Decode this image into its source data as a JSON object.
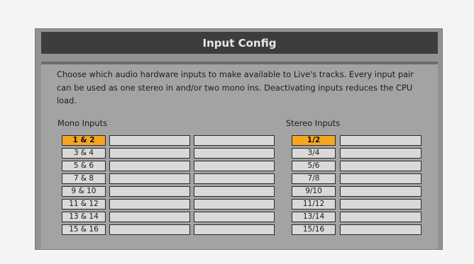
{
  "dialog": {
    "title": "Input Config",
    "description": "Choose which audio hardware inputs to make available to Live's tracks. Every input pair can be used as one stereo in and/or two mono ins.  Deactivating inputs reduces the CPU load."
  },
  "mono": {
    "label": "Mono Inputs",
    "rows": [
      {
        "pair": "1 & 2",
        "active": true
      },
      {
        "pair": "3 & 4",
        "active": false
      },
      {
        "pair": "5 & 6",
        "active": false
      },
      {
        "pair": "7 & 8",
        "active": false
      },
      {
        "pair": "9 & 10",
        "active": false
      },
      {
        "pair": "11 & 12",
        "active": false
      },
      {
        "pair": "13 & 14",
        "active": false
      },
      {
        "pair": "15 & 16",
        "active": false
      }
    ]
  },
  "stereo": {
    "label": "Stereo Inputs",
    "rows": [
      {
        "pair": "1/2",
        "active": true
      },
      {
        "pair": "3/4",
        "active": false
      },
      {
        "pair": "5/6",
        "active": false
      },
      {
        "pair": "7/8",
        "active": false
      },
      {
        "pair": "9/10",
        "active": false
      },
      {
        "pair": "11/12",
        "active": false
      },
      {
        "pair": "13/14",
        "active": false
      },
      {
        "pair": "15/16",
        "active": false
      }
    ]
  },
  "colors": {
    "active": "#f5a623",
    "inactive": "#d9d9d9",
    "titlebar": "#3d3d3d"
  }
}
